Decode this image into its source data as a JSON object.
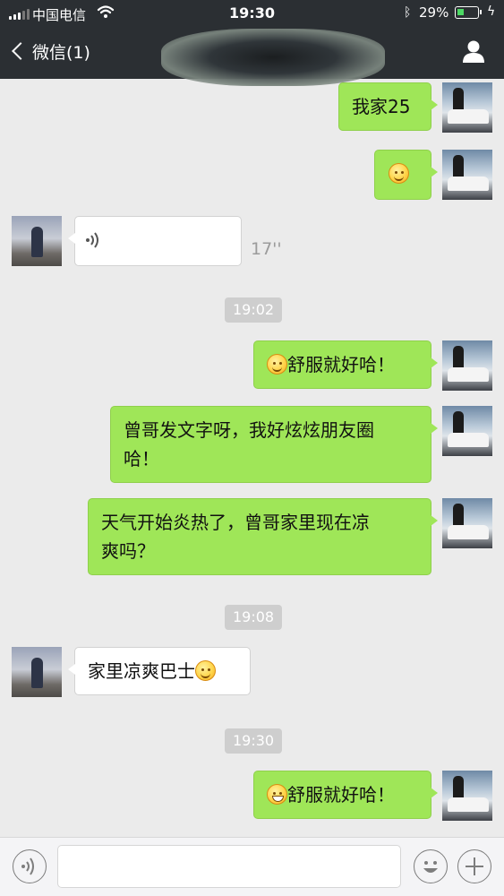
{
  "status_bar": {
    "carrier": "中国电信",
    "time": "19:30",
    "battery": "29%",
    "battery_level": 0.29
  },
  "nav": {
    "back_label": "微信(1)",
    "back_icon": "chevron-left-icon",
    "profile_icon": "person-icon"
  },
  "messages": [
    {
      "from": "me",
      "type": "text",
      "text": "我家25"
    },
    {
      "from": "me",
      "type": "emoji",
      "emoji": "smile"
    },
    {
      "from": "other",
      "type": "voice",
      "duration": "17''"
    },
    {
      "type": "time",
      "text": "19:02"
    },
    {
      "from": "me",
      "type": "text",
      "emoji": "smile",
      "text": "舒服就好哈！"
    },
    {
      "from": "me",
      "type": "text",
      "text": "曾哥发文字呀，我好炫炫朋友圈哈！"
    },
    {
      "from": "me",
      "type": "text",
      "text": "天气开始炎热了，曾哥家里现在凉爽吗？"
    },
    {
      "type": "time",
      "text": "19:08"
    },
    {
      "from": "other",
      "type": "text",
      "text": "家里凉爽巴士",
      "emoji_after": "smile"
    },
    {
      "type": "time",
      "text": "19:30"
    },
    {
      "from": "me",
      "type": "text",
      "emoji": "grin",
      "text": "舒服就好哈！"
    }
  ],
  "chat_text": {
    "m0": "我家25",
    "m4": "舒服就好哈！",
    "m5_l1": "曾哥发文字呀，我好炫炫朋友圈",
    "m5_l2": "哈！",
    "m6_l1": "天气开始炎热了，曾哥家里现在凉",
    "m6_l2": "爽吗？",
    "m8": "家里凉爽巴士",
    "m10": "舒服就好哈！",
    "voice_duration": "17''",
    "t1": "19:02",
    "t2": "19:08",
    "t3": "19:30"
  },
  "input_bar": {
    "voice_icon": "voice-icon",
    "emoji_icon": "emoji-icon",
    "plus_icon": "plus-icon",
    "text_value": ""
  },
  "colors": {
    "header_bg": "#2b2f33",
    "my_bubble": "#9fe658",
    "other_bubble": "#ffffff",
    "chat_bg": "#ebebeb"
  }
}
